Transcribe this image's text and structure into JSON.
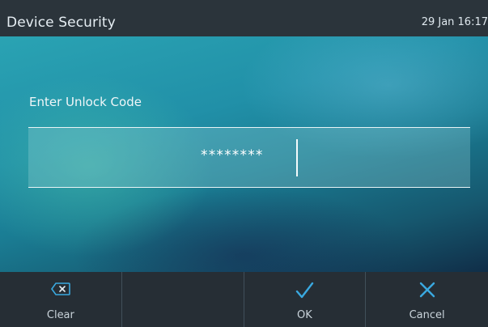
{
  "header": {
    "title": "Device Security",
    "datetime": "29 Jan 16:17"
  },
  "unlock": {
    "prompt": "Enter Unlock Code",
    "masked_value": "********"
  },
  "softkeys": [
    {
      "label": "Clear",
      "icon": "backspace-icon"
    },
    {
      "label": "",
      "icon": ""
    },
    {
      "label": "OK",
      "icon": "checkmark-icon"
    },
    {
      "label": "Cancel",
      "icon": "x-icon"
    }
  ],
  "colors": {
    "accent": "#3aa9e0",
    "title_bar": "#2b343b",
    "softkey_bar": "#262e35"
  }
}
